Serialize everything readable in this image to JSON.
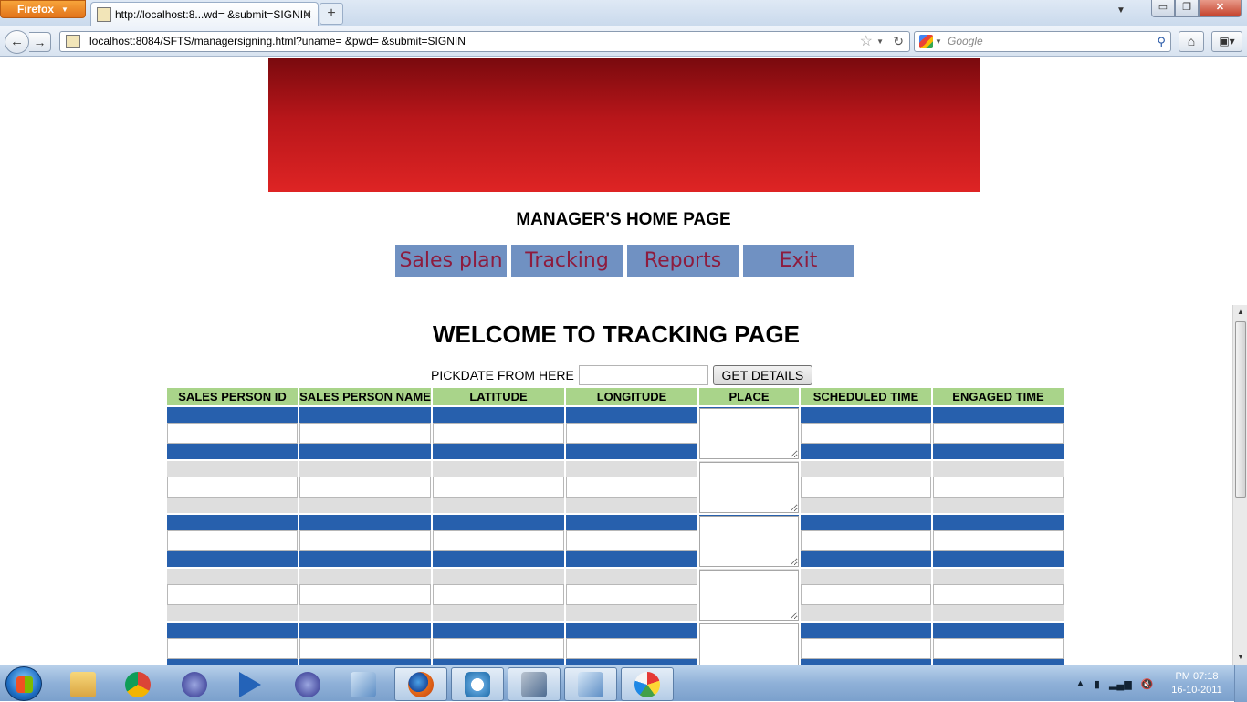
{
  "browser": {
    "app_button": "Firefox",
    "tab_title": "http://localhost:8...wd= &submit=SIGNIN",
    "new_tab": "+",
    "url": "localhost:8084/SFTS/managersigning.html?uname= &pwd= &submit=SIGNIN",
    "search_placeholder": "Google",
    "win_min": "▭",
    "win_max": "❐",
    "win_close": "✕"
  },
  "page": {
    "manager_title": "MANAGER'S HOME PAGE",
    "menu": [
      {
        "label": "Sales plan"
      },
      {
        "label": "Tracking"
      },
      {
        "label": "Reports"
      },
      {
        "label": "Exit"
      }
    ],
    "welcome": "WELCOME TO TRACKING PAGE",
    "pick_label": "PICKDATE FROM HERE",
    "pick_value": "",
    "get_button": "GET DETAILS",
    "table": {
      "headers": [
        "SALES PERSON ID",
        "SALES PERSON NAME",
        "LATITUDE",
        "LONGITUDE",
        "PLACE",
        "SCHEDULED TIME",
        "ENGAGED TIME"
      ],
      "row_colors": [
        "#2760ad",
        "#dedede"
      ],
      "header_color": "#a9d48a"
    }
  },
  "taskbar": {
    "clock_time": "PM 07:18",
    "clock_date": "16-10-2011",
    "apps": [
      "windows-explorer",
      "chrome",
      "eclipse",
      "media-player",
      "eclipse-2",
      "virtualbox",
      "firefox",
      "app-installer",
      "outlook-tool",
      "virtualbox-2",
      "paint"
    ]
  }
}
